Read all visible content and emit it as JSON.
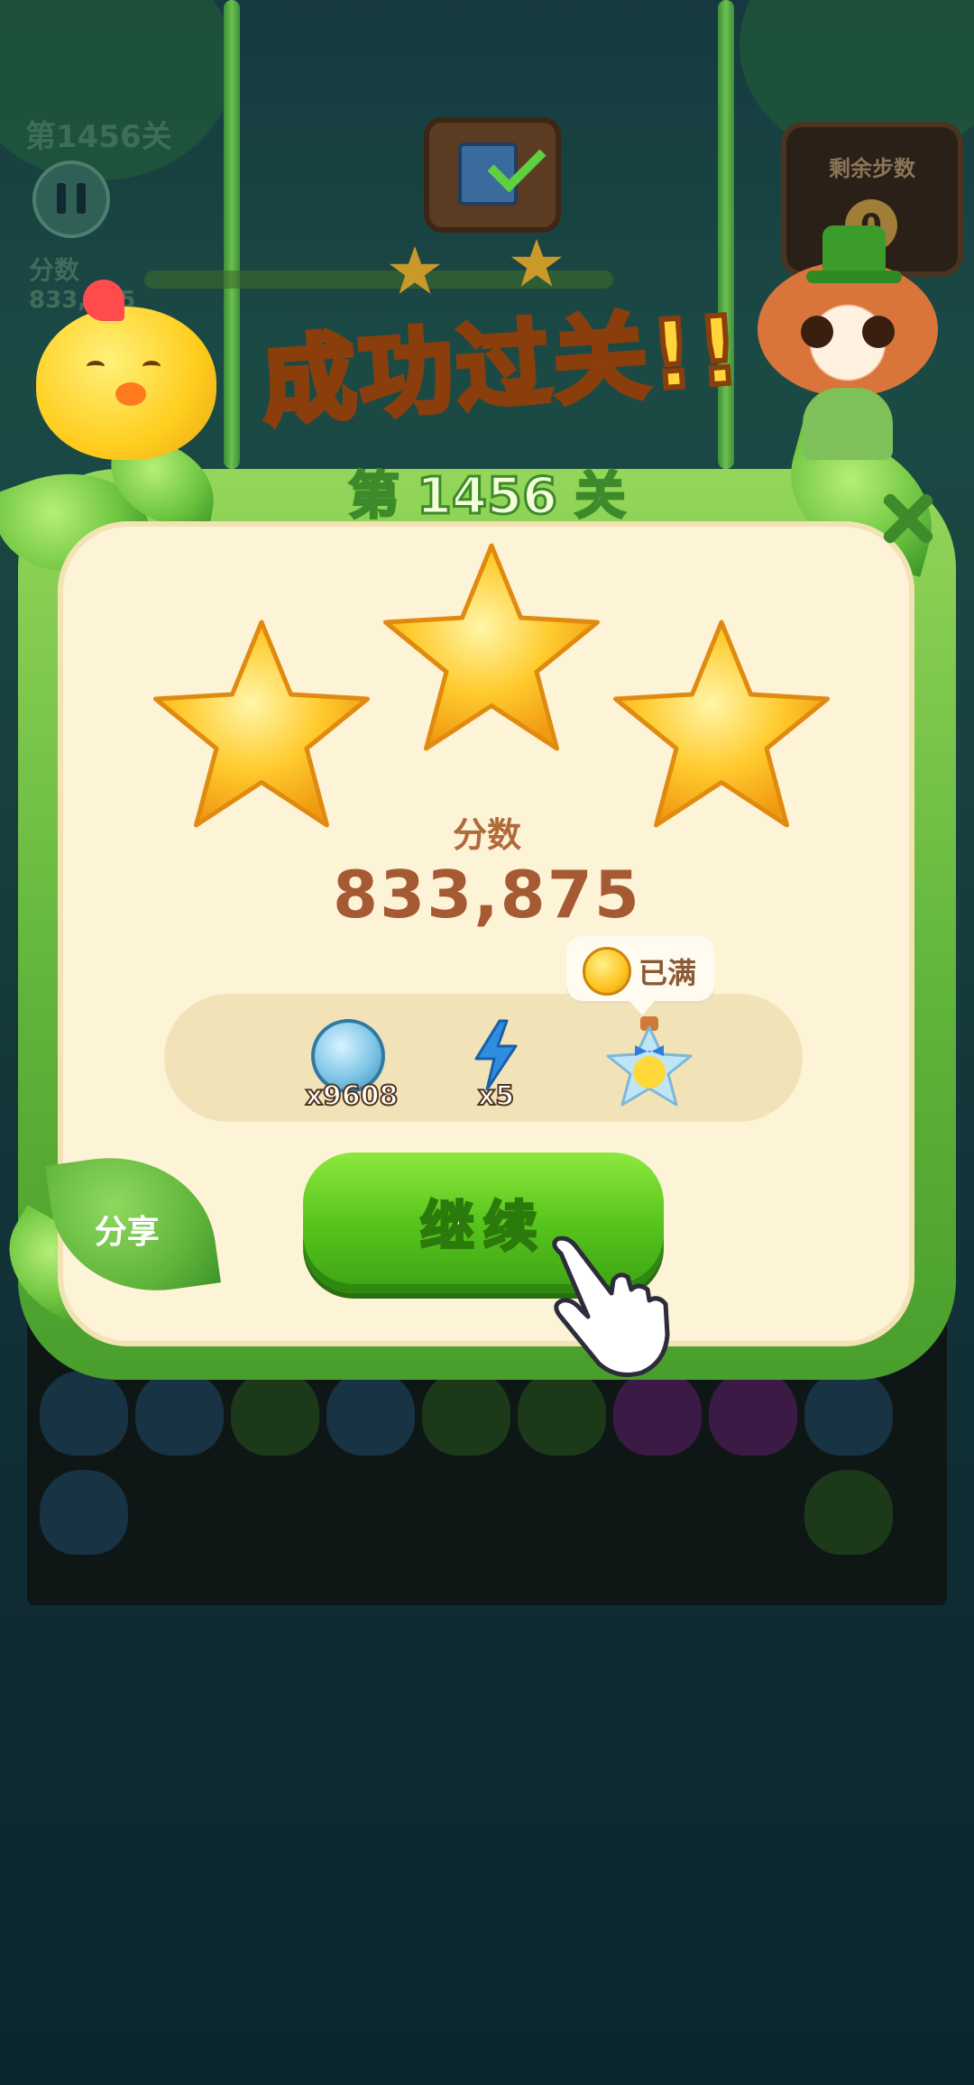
{
  "hud": {
    "level_text": "第1456关",
    "score_label": "分数",
    "score_value": "833,875",
    "moves_label": "剩余步数",
    "moves_value": "0"
  },
  "banner": {
    "title": "成功过关!!",
    "level": "第 1456 关"
  },
  "result": {
    "stars_earned": 3,
    "stars_total": 3,
    "score_label": "分数",
    "score_value": "833,875"
  },
  "rewards": [
    {
      "icon": "silver-leaf-coin-icon",
      "count": "x9608"
    },
    {
      "icon": "lightning-bolt-icon",
      "count": "x5"
    },
    {
      "icon": "star-jar-icon",
      "count": ""
    }
  ],
  "tooltip": {
    "icon": "gold-coin-icon",
    "text": "已满"
  },
  "buttons": {
    "share": "分享",
    "continue": "继续"
  },
  "colors": {
    "panel_bg": "#fdf3d6",
    "frame_green": "#5fb33a",
    "continue_green": "#57c51c",
    "score_brown": "#a55a34",
    "star_gold": "#ffcb2e"
  }
}
